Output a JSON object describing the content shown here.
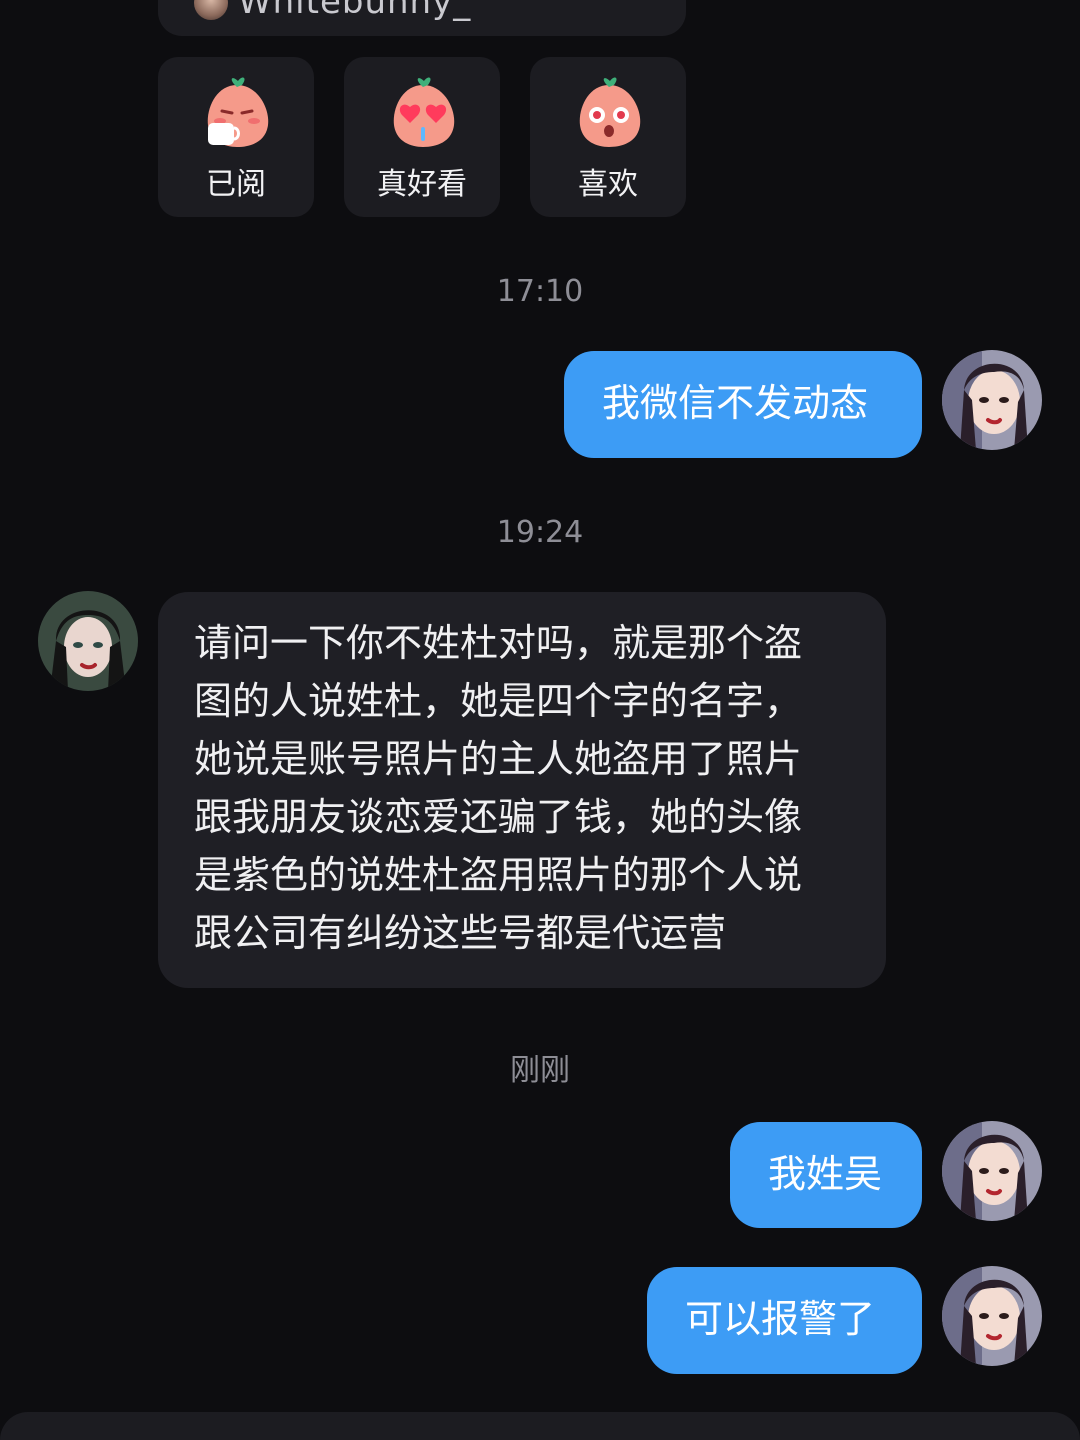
{
  "top_card": {
    "handle": "Whitebunny_"
  },
  "reactions": [
    {
      "label": "已阅",
      "icon": "peach-mug-emoji-icon"
    },
    {
      "label": "真好看",
      "icon": "peach-heart-eyes-emoji-icon"
    },
    {
      "label": "喜欢",
      "icon": "peach-star-eyes-emoji-icon"
    }
  ],
  "messages": {
    "ts1": "17:10",
    "msg1": "我微信不发动态",
    "ts2": "19:24",
    "msg2_lines": [
      "请问一下你不姓杜对吗，就是那个盗",
      "图的人说姓杜，她是四个字的名字，",
      "她说是账号照片的主人她盗用了照片",
      "跟我朋友谈恋爱还骗了钱，她的头像",
      "是紫色的说姓杜盗用照片的那个人说",
      "跟公司有纠纷这些号都是代运营"
    ],
    "ts3": "刚刚",
    "msg3": "我姓吴",
    "msg4": "可以报警了"
  },
  "colors": {
    "background": "#0d0d10",
    "outgoing_bubble": "#3d9cf5",
    "incoming_bubble": "#1f1f25",
    "card": "#1c1c21",
    "timestamp": "#8e8e96"
  }
}
